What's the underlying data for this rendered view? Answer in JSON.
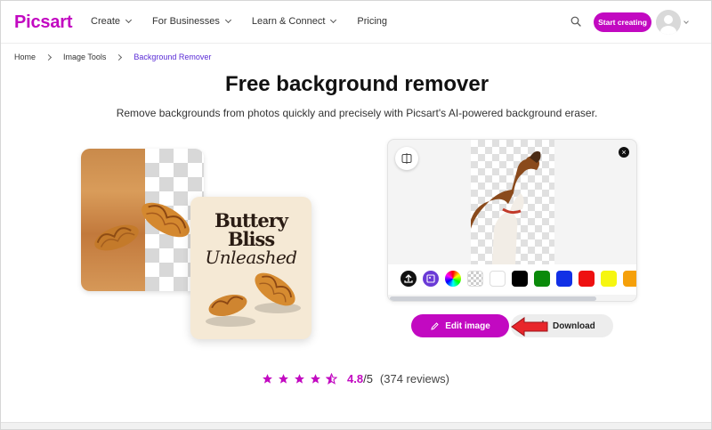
{
  "header": {
    "logo": "Picsart",
    "nav": [
      {
        "label": "Create",
        "has_dropdown": true
      },
      {
        "label": "For Businesses",
        "has_dropdown": true
      },
      {
        "label": "Learn & Connect",
        "has_dropdown": true
      },
      {
        "label": "Pricing",
        "has_dropdown": false
      }
    ],
    "search_icon": "search-icon",
    "cta_label": "Start creating",
    "brand_color": "#c209c1"
  },
  "breadcrumb": [
    "Home",
    "Image Tools",
    "Background Remover"
  ],
  "hero": {
    "title": "Free background remover",
    "subtitle": "Remove backgrounds from photos quickly and precisely with Picsart's AI-powered background eraser."
  },
  "illustration": {
    "card_line1": "Buttery",
    "card_line2": "Bliss",
    "card_line3": "Unleashed"
  },
  "editor": {
    "compare_icon": "compare-icon",
    "close_icon": "close-icon",
    "tool_icons": [
      "upload-icon",
      "image-replace-icon",
      "color-wheel-icon",
      "transparent-icon"
    ],
    "swatches": [
      "#ffffff",
      "#000000",
      "#0a8a0a",
      "#1230e6",
      "#ee1111",
      "#f6f611",
      "#f5a00a"
    ],
    "edit_label": "Edit image",
    "download_label": "Download"
  },
  "rating": {
    "stars": 4.5,
    "value": "4.8",
    "max": "/5",
    "count": "(374 reviews)"
  }
}
